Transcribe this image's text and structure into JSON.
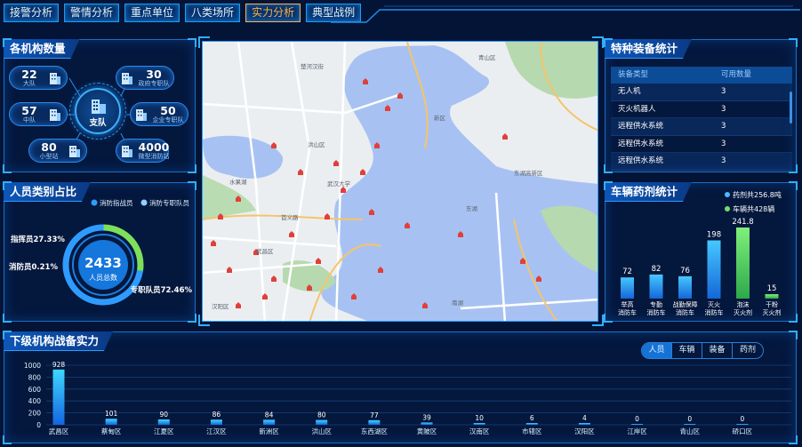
{
  "nav": [
    "接警分析",
    "警情分析",
    "重点单位",
    "八类场所",
    "实力分析",
    "典型战例"
  ],
  "nav_active": 4,
  "org": {
    "title": "各机构数量",
    "center": "支队",
    "items": [
      {
        "num": "22",
        "label": "大队"
      },
      {
        "num": "30",
        "label": "政府专职队"
      },
      {
        "num": "57",
        "label": "中队"
      },
      {
        "num": "50",
        "label": "企业专职队"
      },
      {
        "num": "80",
        "label": "小型站"
      },
      {
        "num": "4000",
        "label": "微型消防站"
      }
    ]
  },
  "staff": {
    "title": "人员类别占比",
    "legend": [
      "消防指战员",
      "消防专职队员"
    ],
    "total": "2433",
    "total_label": "人员总数",
    "labels": [
      "指挥员27.33%",
      "消防员0.21%",
      "专职队员72.46%"
    ],
    "shares": [
      27.33,
      0.21,
      72.46
    ],
    "colors": [
      "#7ee05a",
      "#2ecfc0",
      "#2f9bff"
    ]
  },
  "equip": {
    "title": "特种装备统计",
    "headers": [
      "装备类型",
      "可用数量"
    ],
    "rows": [
      [
        "无人机",
        "3"
      ],
      [
        "灭火机器人",
        "3"
      ],
      [
        "远程供水系统",
        "3"
      ],
      [
        "远程供水系统",
        "3"
      ],
      [
        "远程供水系统",
        "3"
      ]
    ]
  },
  "vehicle": {
    "title": "车辆药剂统计",
    "legend": [
      "药剂共256.8吨",
      "车辆共428辆"
    ],
    "chart_data": {
      "type": "bar",
      "categories": [
        [
          "举高",
          "消防车"
        ],
        [
          "专勤",
          "消防车"
        ],
        [
          "战勤保障",
          "消防车"
        ],
        [
          "灭火",
          "消防车"
        ],
        [
          "泡沫",
          "灭火剂"
        ],
        [
          "干粉",
          "灭火剂"
        ]
      ],
      "values": [
        72,
        82,
        76,
        198,
        241.8,
        15
      ],
      "value_labels": [
        "72",
        "82",
        "76",
        "198",
        "241.8",
        "15"
      ],
      "series_kind": [
        "vehicle",
        "vehicle",
        "vehicle",
        "vehicle",
        "agent",
        "agent"
      ],
      "ylim": [
        0,
        260
      ]
    }
  },
  "lower": {
    "title": "下级机构战备实力",
    "tabs": [
      "人员",
      "车辆",
      "装备",
      "药剂"
    ],
    "active_tab": 0,
    "chart_data": {
      "type": "bar",
      "categories": [
        "武昌区",
        "蔡甸区",
        "江夏区",
        "江汉区",
        "新洲区",
        "洪山区",
        "东西湖区",
        "黄陂区",
        "汉南区",
        "市辖区",
        "汉阳区",
        "江岸区",
        "青山区",
        "硚口区"
      ],
      "values": [
        928,
        101,
        90,
        86,
        84,
        80,
        77,
        39,
        10,
        6,
        4,
        0,
        0,
        0
      ],
      "yticks": [
        0,
        200,
        400,
        600,
        800,
        1000
      ],
      "ylim": [
        0,
        1000
      ]
    }
  },
  "map": {
    "labels": [
      "东湖",
      "洪山区",
      "武昌区",
      "青山区",
      "东湖高新区",
      "楚河汉街",
      "武汉大学",
      "水果湖",
      "南湖",
      "汉阳区",
      "首义路",
      "新区"
    ]
  }
}
